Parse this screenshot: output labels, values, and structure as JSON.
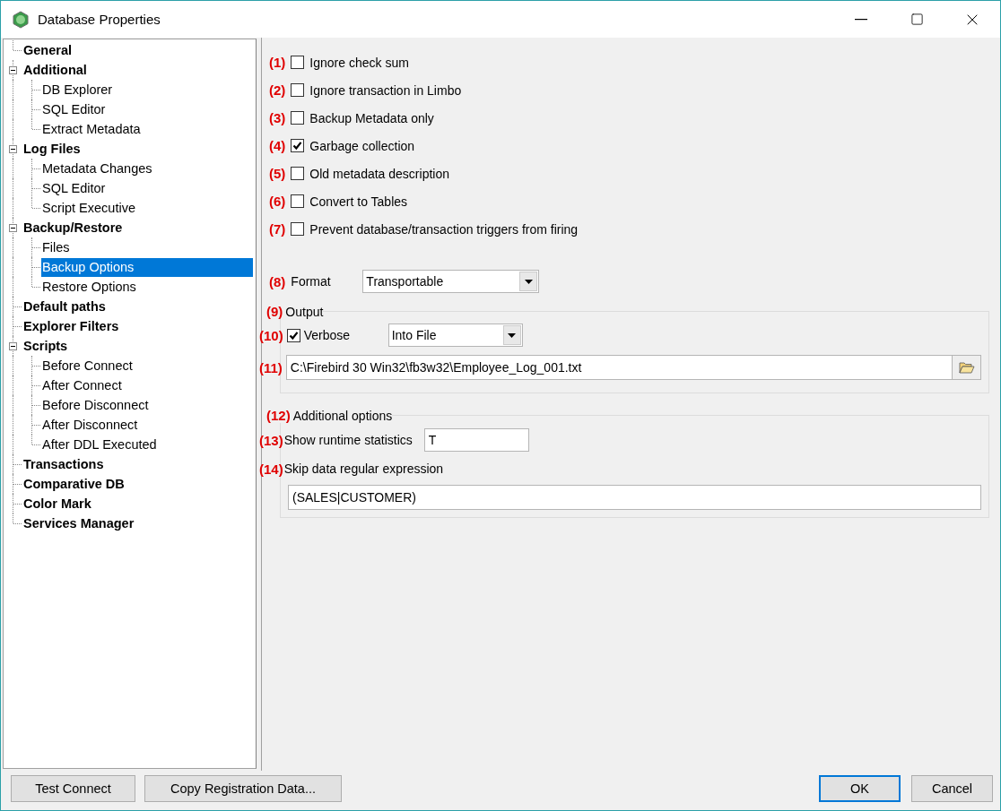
{
  "window": {
    "title": "Database Properties"
  },
  "tree": [
    {
      "label": "General",
      "selected": false
    },
    {
      "label": "Additional",
      "expanded": true,
      "selected": false,
      "children": [
        {
          "label": "DB Explorer",
          "selected": false
        },
        {
          "label": "SQL Editor",
          "selected": false
        },
        {
          "label": "Extract Metadata",
          "selected": false
        }
      ]
    },
    {
      "label": "Log Files",
      "expanded": true,
      "selected": false,
      "children": [
        {
          "label": "Metadata Changes",
          "selected": false
        },
        {
          "label": "SQL Editor",
          "selected": false
        },
        {
          "label": "Script Executive",
          "selected": false
        }
      ]
    },
    {
      "label": "Backup/Restore",
      "expanded": true,
      "selected": false,
      "children": [
        {
          "label": "Files",
          "selected": false
        },
        {
          "label": "Backup Options",
          "selected": true
        },
        {
          "label": "Restore Options",
          "selected": false
        }
      ]
    },
    {
      "label": "Default paths",
      "selected": false
    },
    {
      "label": "Explorer Filters",
      "selected": false
    },
    {
      "label": "Scripts",
      "expanded": true,
      "selected": false,
      "children": [
        {
          "label": "Before Connect",
          "selected": false
        },
        {
          "label": "After Connect",
          "selected": false
        },
        {
          "label": "Before Disconnect",
          "selected": false
        },
        {
          "label": "After Disconnect",
          "selected": false
        },
        {
          "label": "After DDL Executed",
          "selected": false
        }
      ]
    },
    {
      "label": "Transactions",
      "selected": false
    },
    {
      "label": "Comparative DB",
      "selected": false
    },
    {
      "label": "Color Mark",
      "selected": false
    },
    {
      "label": "Services Manager",
      "selected": false
    }
  ],
  "options": [
    {
      "marker": "(1)",
      "label": "Ignore check sum",
      "checked": false
    },
    {
      "marker": "(2)",
      "label": "Ignore transaction in Limbo",
      "checked": false
    },
    {
      "marker": "(3)",
      "label": "Backup Metadata only",
      "checked": false
    },
    {
      "marker": "(4)",
      "label": "Garbage collection",
      "checked": true
    },
    {
      "marker": "(5)",
      "label": "Old metadata description",
      "checked": false
    },
    {
      "marker": "(6)",
      "label": "Convert to Tables",
      "checked": false
    },
    {
      "marker": "(7)",
      "label": "Prevent database/transaction triggers from firing",
      "checked": false
    }
  ],
  "format": {
    "marker": "(8)",
    "label": "Format",
    "value": "Transportable"
  },
  "output": {
    "marker": "(9)",
    "title": "Output",
    "verbose": {
      "marker": "(10)",
      "label": "Verbose",
      "checked": true
    },
    "destination": "Into File",
    "file": {
      "marker": "(11)",
      "value": "C:\\Firebird 30 Win32\\fb3w32\\Employee_Log_001.txt"
    }
  },
  "additional": {
    "marker": "(12)",
    "title": "Additional options",
    "runtime_stats": {
      "marker": "(13)",
      "label": "Show runtime statistics",
      "value": "T"
    },
    "skip_regex": {
      "marker": "(14)",
      "label": "Skip data regular expression",
      "value": "(SALES|CUSTOMER)"
    }
  },
  "buttons_left": [
    {
      "label": "Test Connect",
      "default": false
    },
    {
      "label": "Copy Registration Data...",
      "default": false
    }
  ],
  "buttons_right": [
    {
      "label": "OK",
      "default": true
    },
    {
      "label": "Cancel",
      "default": false
    }
  ]
}
